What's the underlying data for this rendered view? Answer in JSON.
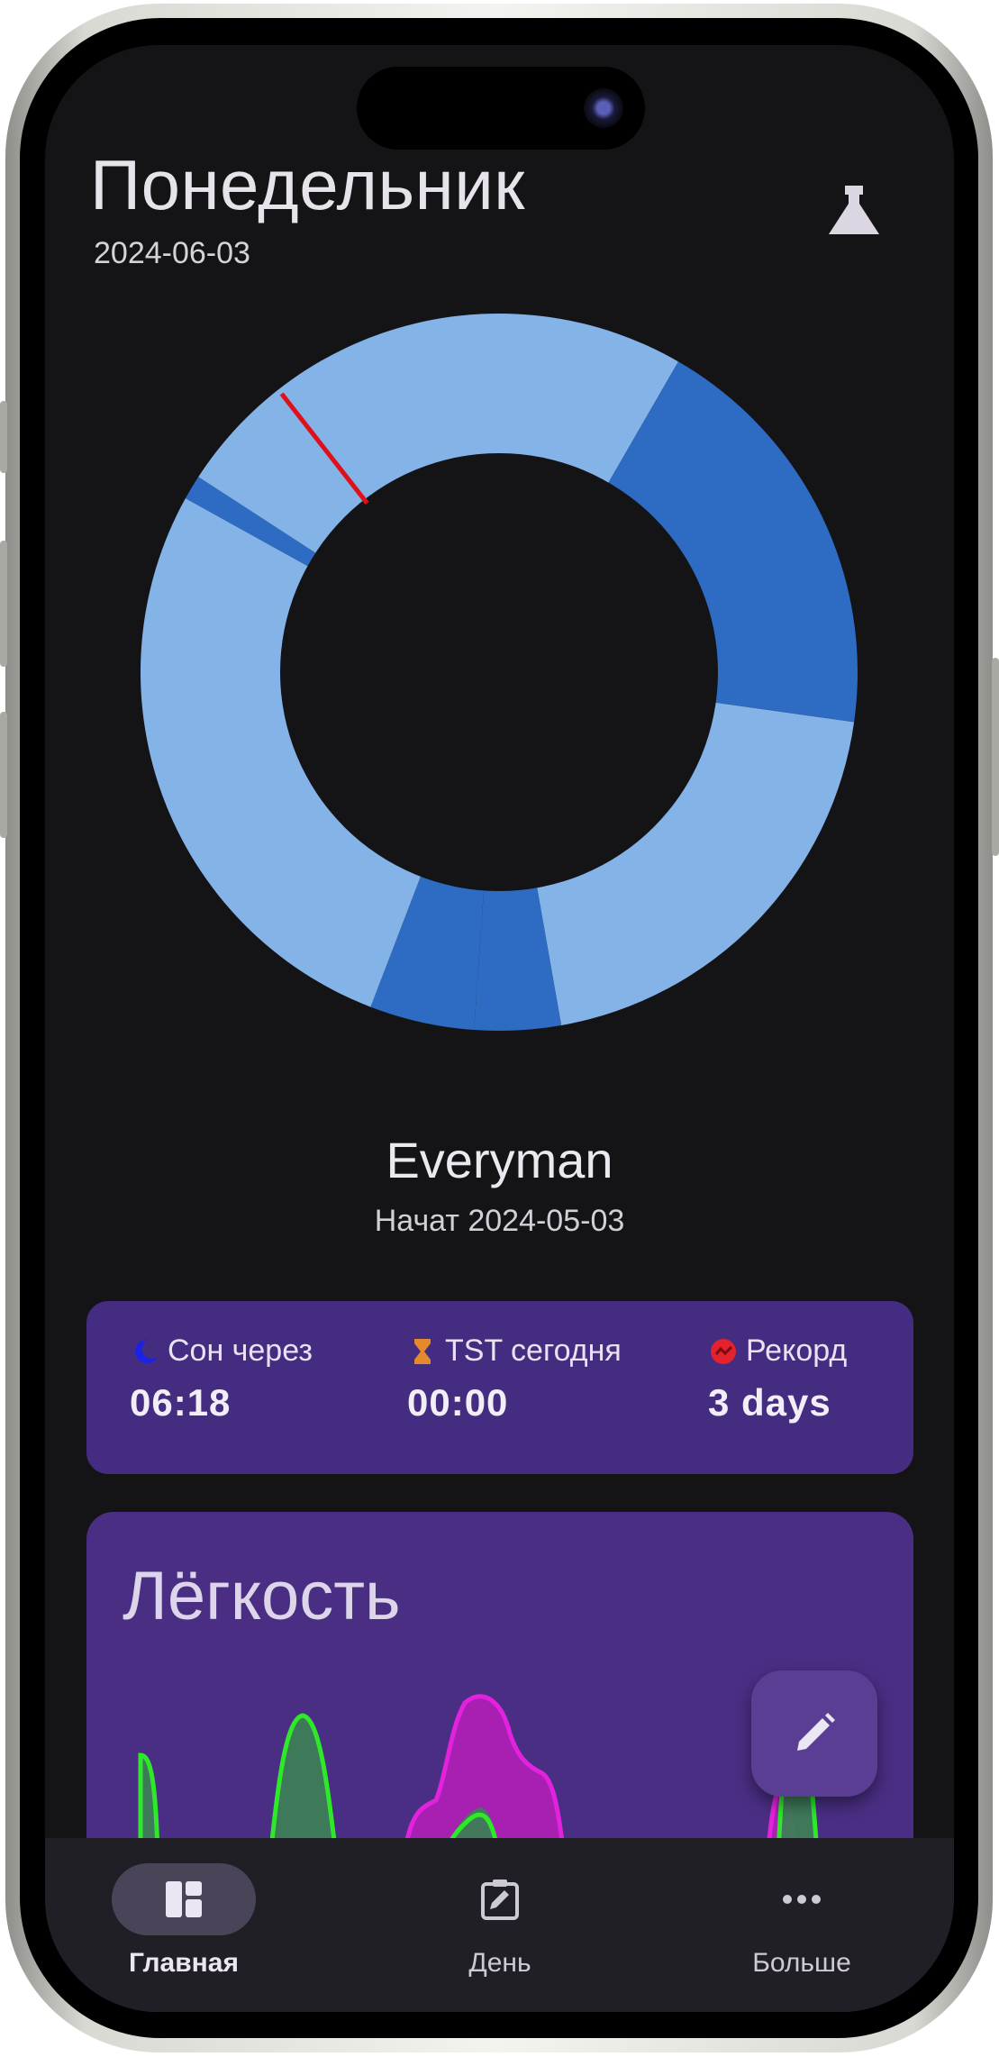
{
  "header": {
    "title": "Понедельник",
    "date": "2024-06-03"
  },
  "icons": {
    "lab": "flask-icon",
    "sleep": "moon-icon",
    "tst": "hourglass-icon",
    "record": "record-icon",
    "edit": "pencil-icon",
    "nav_home": "dashboard-icon",
    "nav_day": "clipboard-edit-icon",
    "nav_more": "more-dots-icon"
  },
  "chart_data": [
    {
      "type": "pie",
      "title": "",
      "hole": true,
      "segments": [
        {
          "start_deg": 8,
          "end_deg": 80,
          "shade": "light"
        },
        {
          "start_deg": 80,
          "end_deg": 94,
          "shade": "dark"
        },
        {
          "start_deg": 94,
          "end_deg": 111,
          "shade": "dark"
        },
        {
          "start_deg": 111,
          "end_deg": 209,
          "shade": "light"
        },
        {
          "start_deg": 209,
          "end_deg": 213,
          "shade": "dark"
        },
        {
          "start_deg": 213,
          "end_deg": 300,
          "shade": "light"
        },
        {
          "start_deg": 300,
          "end_deg": 368,
          "shade": "dark"
        }
      ],
      "current_time_deg": 232,
      "colors": {
        "light": "#84b3e8",
        "dark": "#2e6bc2",
        "marker": "#e0101a"
      }
    },
    {
      "type": "area",
      "title": "Лёгкость",
      "series": [
        {
          "name": "",
          "color": "#2ee829"
        },
        {
          "name": "",
          "color": "#e222dc"
        }
      ],
      "baseline": true
    }
  ],
  "schedule": {
    "name": "Everyman",
    "started": "Начат 2024-05-03"
  },
  "stats": {
    "sleep_in": {
      "label": "Сон через",
      "value": "06:18",
      "color": "#1a22e6"
    },
    "tst_today": {
      "label": "TST сегодня",
      "value": "00:00",
      "color": "#e58a2c"
    },
    "record": {
      "label": "Рекорд",
      "value": "3 days",
      "color": "#e2232e"
    }
  },
  "lightness": {
    "title": "Лёгкость"
  },
  "nav": {
    "home": "Главная",
    "day": "День",
    "more": "Больше"
  },
  "colors": {
    "background": "#141316",
    "card": "#442c80",
    "accent": "#5a3e94"
  }
}
